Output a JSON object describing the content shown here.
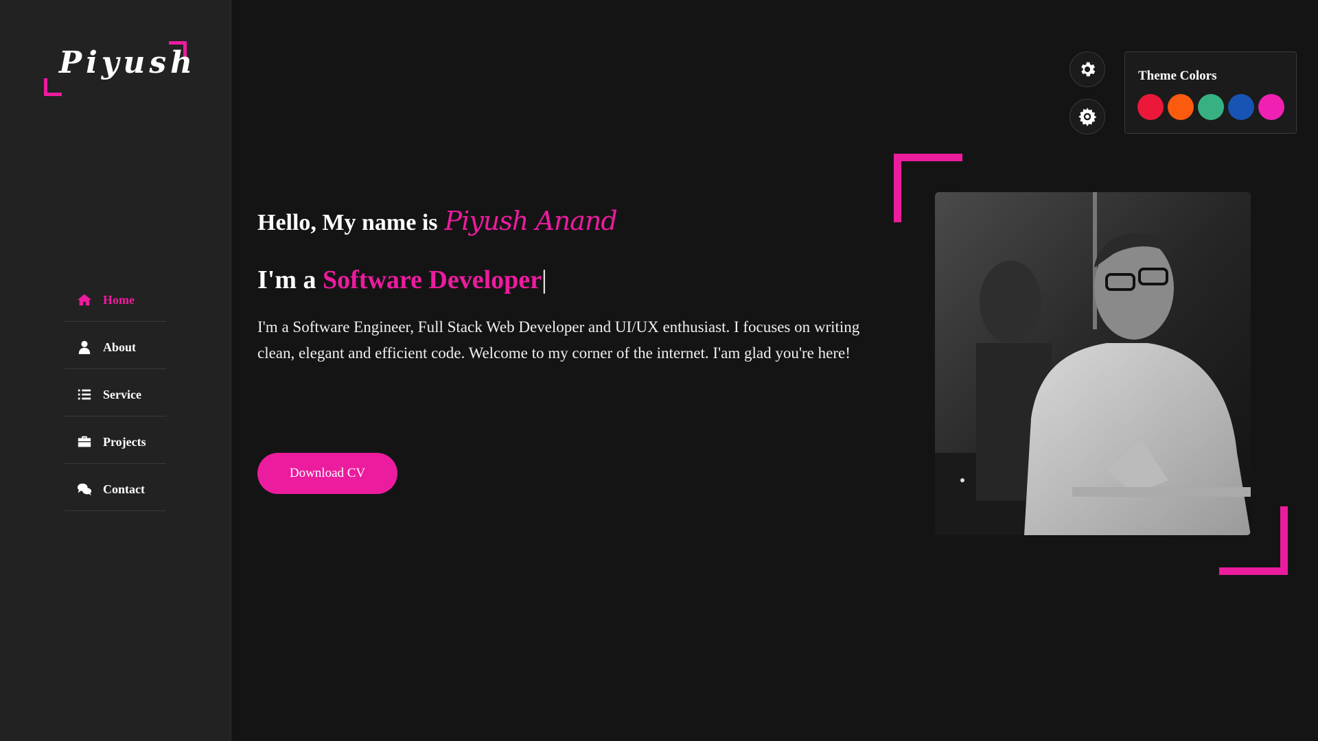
{
  "logo": {
    "text": "Piyush"
  },
  "nav": {
    "items": [
      {
        "label": "Home",
        "icon": "home-icon",
        "active": true
      },
      {
        "label": "About",
        "icon": "user-icon",
        "active": false
      },
      {
        "label": "Service",
        "icon": "list-icon",
        "active": false
      },
      {
        "label": "Projects",
        "icon": "briefcase-icon",
        "active": false
      },
      {
        "label": "Contact",
        "icon": "chat-icon",
        "active": false
      }
    ]
  },
  "hero": {
    "greeting": "Hello, My name is",
    "name": "Piyush Anand",
    "role_prefix": "I'm a",
    "role": "Software Developer",
    "cursor": "|",
    "bio": "I'm a Software Engineer, Full Stack Web Developer and UI/UX enthusiast. I focuses on writing clean, elegant and efficient code. Welcome to my corner of the internet. I'am glad you're here!",
    "cv_button": "Download CV"
  },
  "theme": {
    "title": "Theme Colors",
    "colors": [
      "#ec1839",
      "#fa5b0f",
      "#37b182",
      "#1854b4",
      "#f021b2"
    ],
    "accent": "#ec1c9e"
  },
  "settings": {
    "icons": [
      "gear-icon",
      "sun-gear-icon"
    ]
  }
}
